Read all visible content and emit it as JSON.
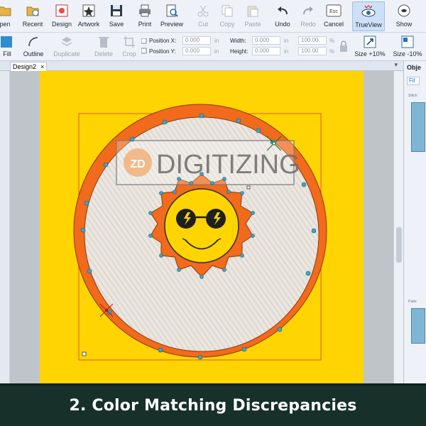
{
  "toolbar_main": {
    "items": [
      {
        "label": "pen",
        "icon": "folder-icon",
        "disabled": false
      },
      {
        "label": "Recent",
        "icon": "recent-folder-icon",
        "disabled": false
      },
      {
        "label": "Design",
        "icon": "design-icon",
        "disabled": false
      },
      {
        "label": "Artwork",
        "icon": "artwork-icon",
        "disabled": false
      },
      {
        "label": "Save",
        "icon": "floppy-disk-icon",
        "disabled": false
      },
      {
        "label": "Print",
        "icon": "printer-icon",
        "disabled": false
      },
      {
        "label": "Preview",
        "icon": "preview-icon",
        "disabled": false
      },
      {
        "label": "Cut",
        "icon": "scissors-icon",
        "disabled": true
      },
      {
        "label": "Copy",
        "icon": "copy-icon",
        "disabled": true
      },
      {
        "label": "Paste",
        "icon": "paste-icon",
        "disabled": true
      },
      {
        "label": "Undo",
        "icon": "undo-icon",
        "disabled": false
      },
      {
        "label": "Redo",
        "icon": "redo-icon",
        "disabled": true
      },
      {
        "label": "Cancel",
        "icon": "escape-key-icon",
        "disabled": false
      },
      {
        "label": "TrueView",
        "icon": "eye-icon",
        "disabled": false,
        "active": true
      },
      {
        "label": "Show",
        "icon": "show-eye-icon",
        "disabled": false
      }
    ]
  },
  "toolbar_edit": {
    "fill_label": "Fill",
    "outline_label": "Outline",
    "duplicate_label": "Duplicate",
    "delete_label": "Delete",
    "crop_label": "Crop",
    "position_x_label": "Position X:",
    "position_y_label": "Position Y:",
    "position_x_value": "0.000",
    "position_y_value": "0.000",
    "width_label": "Width:",
    "height_label": "Height:",
    "width_value": "0.000",
    "height_value": "0.000",
    "unit_in": "in",
    "unit_pct": "%",
    "width_pct": "100.00",
    "height_pct": "100.00",
    "size_up_label": "Size +10%",
    "size_down_label": "Size -10%"
  },
  "document_tab": {
    "title": "Design2",
    "close": "×"
  },
  "canvas": {
    "watermark_text": "DIGITIZING",
    "watermark_badge": "ZD"
  },
  "right_panel": {
    "title": "Obje",
    "tab": "Fil",
    "stitch_label": "Stitch",
    "pattern_label": "Patte"
  },
  "banner": {
    "text": "2. Color Matching Discrepancies"
  },
  "colors": {
    "background_yellow": "#ffd400",
    "ring_orange": "#f26a1b",
    "fill_stitch": "#e7e2dc",
    "banner_bg": "#17302a"
  }
}
